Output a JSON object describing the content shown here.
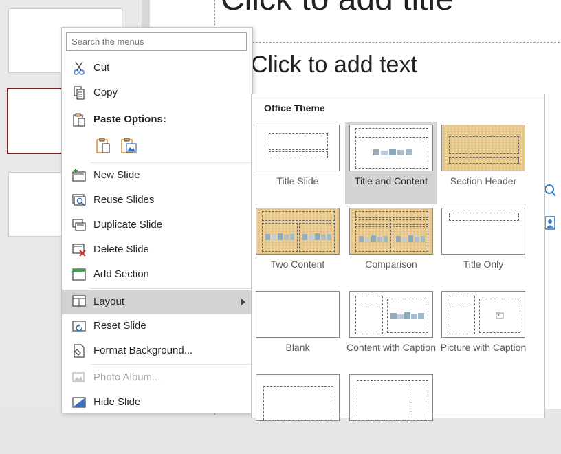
{
  "slide": {
    "title_placeholder": "Click to add title",
    "body_placeholder": "Click to add text"
  },
  "menu": {
    "search_placeholder": "Search the menus",
    "cut": "Cut",
    "copy": "Copy",
    "paste_options": "Paste Options:",
    "new_slide": "New Slide",
    "reuse_slides": "Reuse Slides",
    "duplicate_slide": "Duplicate Slide",
    "delete_slide": "Delete Slide",
    "add_section": "Add Section",
    "layout": "Layout",
    "reset_slide": "Reset Slide",
    "format_background": "Format Background...",
    "photo_album": "Photo Album...",
    "hide_slide": "Hide Slide"
  },
  "gallery": {
    "title": "Office Theme",
    "layouts": [
      "Title Slide",
      "Title and Content",
      "Section Header",
      "Two Content",
      "Comparison",
      "Title Only",
      "Blank",
      "Content with Caption",
      "Picture with Caption"
    ],
    "selected": "Title and Content"
  },
  "colors": {
    "selected_thumb_border": "#7a1f1f",
    "highlight": "#d4d4d4",
    "theme_tan": "#e9c98a"
  }
}
